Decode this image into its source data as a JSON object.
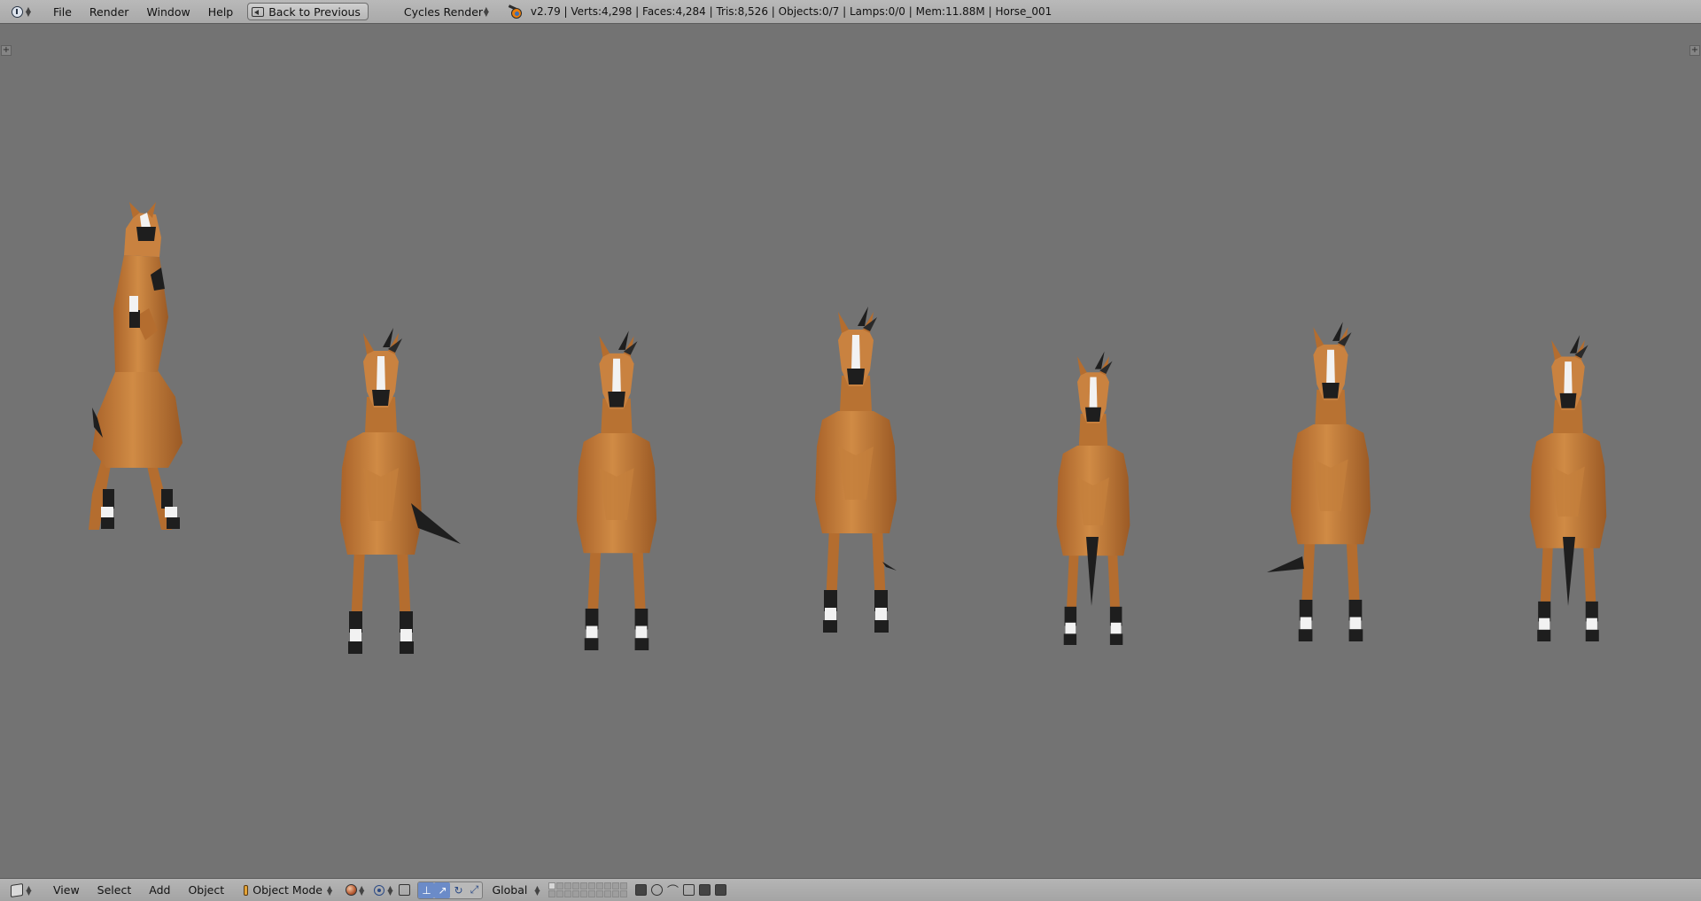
{
  "topbar": {
    "editor_icon": "info-icon",
    "menus": [
      "File",
      "Render",
      "Window",
      "Help"
    ],
    "back_button": "Back to Previous",
    "render_engine": "Cycles Render",
    "stats": "v2.79 | Verts:4,298 | Faces:4,284 | Tris:8,526 | Objects:0/7 | Lamps:0/0 | Mem:11.88M | Horse_001"
  },
  "viewport": {
    "background": "#737373",
    "horse_color": "#c27a34",
    "marking_color": "#f2f2f2",
    "hoof_color": "#1e1e1e",
    "horse_count": 7
  },
  "bottombar": {
    "editor_icon": "cube-icon",
    "menus": [
      "View",
      "Select",
      "Add",
      "Object"
    ],
    "mode": "Object Mode",
    "orientation": "Global"
  }
}
